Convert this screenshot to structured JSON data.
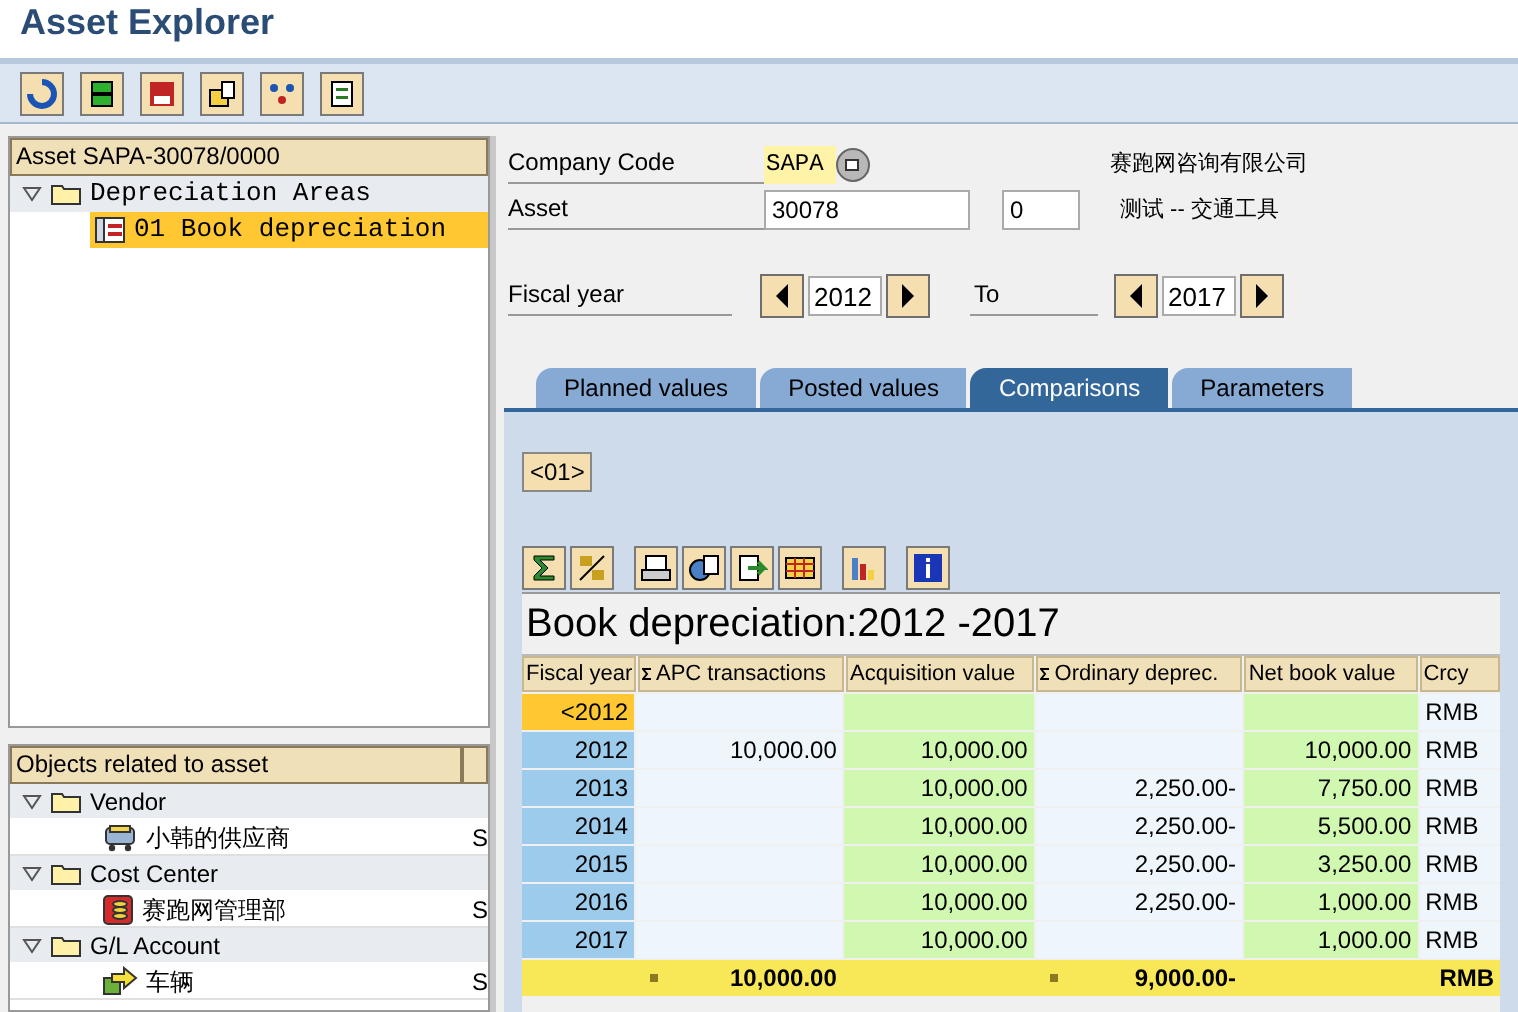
{
  "window": {
    "title": "Asset Explorer"
  },
  "tree": {
    "header": "Asset SAPA-30078/0000",
    "items": [
      {
        "label": "Depreciation Areas",
        "expanded": true,
        "children": [
          {
            "label": "01 Book depreciation",
            "selected": true
          }
        ]
      }
    ]
  },
  "related": {
    "header": "Objects related to asset",
    "items": [
      {
        "label": "Vendor",
        "expanded": true,
        "children": [
          {
            "label": "小韩的供应商",
            "kind": "vendor",
            "column_2": "S"
          }
        ]
      },
      {
        "label": "Cost Center",
        "expanded": true,
        "children": [
          {
            "label": "赛跑网管理部",
            "kind": "costcenter",
            "column_2": "S"
          }
        ]
      },
      {
        "label": "G/L Account",
        "expanded": true,
        "children": [
          {
            "label": "车辆",
            "kind": "account",
            "column_2": "S"
          }
        ]
      }
    ]
  },
  "form": {
    "company_code": {
      "label": "Company Code",
      "value": "SAPA",
      "description": "赛跑网咨询有限公司"
    },
    "asset": {
      "label": "Asset",
      "value": "30078",
      "sub_number": "0",
      "description": "测试 -- 交通工具"
    },
    "fiscal_year": {
      "label": "Fiscal year",
      "from": "2012",
      "to_label": "To",
      "to": "2017"
    }
  },
  "tabs": [
    {
      "label": "Planned values",
      "selected": false
    },
    {
      "label": "Posted values",
      "selected": false
    },
    {
      "label": "Comparisons",
      "selected": true
    },
    {
      "label": "Parameters",
      "selected": false
    }
  ],
  "area_button": "<01>",
  "report": {
    "title": "Book depreciation:2012 -2017",
    "columns": [
      {
        "label": "Fiscal year",
        "sum": false
      },
      {
        "label": "APC transactions",
        "sum": true
      },
      {
        "label": "Acquisition value",
        "sum": false
      },
      {
        "label": "Ordinary deprec.",
        "sum": true
      },
      {
        "label": "Net book value",
        "sum": false
      },
      {
        "label": "Crcy",
        "sum": false
      }
    ],
    "rows": [
      {
        "selected": true,
        "cells": [
          "<2012",
          "",
          "",
          "",
          "",
          "RMB"
        ]
      },
      {
        "selected": false,
        "cells": [
          "2012",
          "10,000.00",
          "10,000.00",
          "",
          "10,000.00",
          "RMB"
        ]
      },
      {
        "selected": false,
        "cells": [
          "2013",
          "",
          "10,000.00",
          "2,250.00-",
          "7,750.00",
          "RMB"
        ]
      },
      {
        "selected": false,
        "cells": [
          "2014",
          "",
          "10,000.00",
          "2,250.00-",
          "5,500.00",
          "RMB"
        ]
      },
      {
        "selected": false,
        "cells": [
          "2015",
          "",
          "10,000.00",
          "2,250.00-",
          "3,250.00",
          "RMB"
        ]
      },
      {
        "selected": false,
        "cells": [
          "2016",
          "",
          "10,000.00",
          "2,250.00-",
          "1,000.00",
          "RMB"
        ]
      },
      {
        "selected": false,
        "cells": [
          "2017",
          "",
          "10,000.00",
          "",
          "1,000.00",
          "RMB"
        ]
      }
    ],
    "totals": {
      "apc_transactions": "10,000.00",
      "ordinary_deprec": "9,000.00-",
      "currency": "RMB"
    }
  }
}
